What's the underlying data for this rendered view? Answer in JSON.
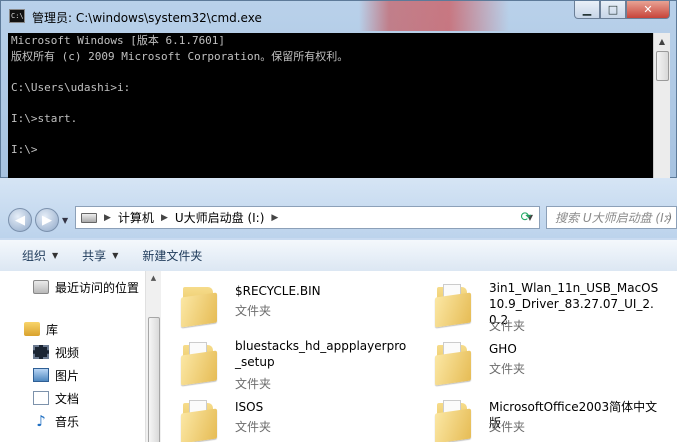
{
  "cmd": {
    "title": "管理员: C:\\windows\\system32\\cmd.exe",
    "icon_label": "C:\\",
    "lines": [
      "Microsoft Windows [版本 6.1.7601]",
      "版权所有 (c) 2009 Microsoft Corporation。保留所有权利。",
      "",
      "C:\\Users\\udashi>i:",
      "",
      "I:\\>start.",
      "",
      "I:\\>"
    ],
    "controls": {
      "minimize": "▁",
      "maximize": "□",
      "close": "✕"
    }
  },
  "explorer": {
    "breadcrumb": [
      "计算机",
      "U大师启动盘 (I:)"
    ],
    "search_placeholder": "搜索 U大师启动盘 (I:)",
    "toolbar": {
      "organize": "组织",
      "share": "共享",
      "new_folder": "新建文件夹"
    },
    "nav": {
      "recent": "最近访问的位置",
      "libraries": "库",
      "video": "视频",
      "pictures": "图片",
      "documents": "文档",
      "music": "音乐"
    },
    "items": [
      {
        "name": "$RECYCLE.BIN",
        "type": "文件夹"
      },
      {
        "name": "3in1_Wlan_11n_USB_MacOS10.9_Driver_83.27.07_UI_2.0.2",
        "type": "文件夹"
      },
      {
        "name": "bluestacks_hd_appplayerpro_setup",
        "type": "文件夹"
      },
      {
        "name": "GHO",
        "type": "文件夹"
      },
      {
        "name": "ISOS",
        "type": "文件夹"
      },
      {
        "name": "MicrosoftOffice2003简体中文版",
        "type": "文件夹"
      }
    ]
  }
}
